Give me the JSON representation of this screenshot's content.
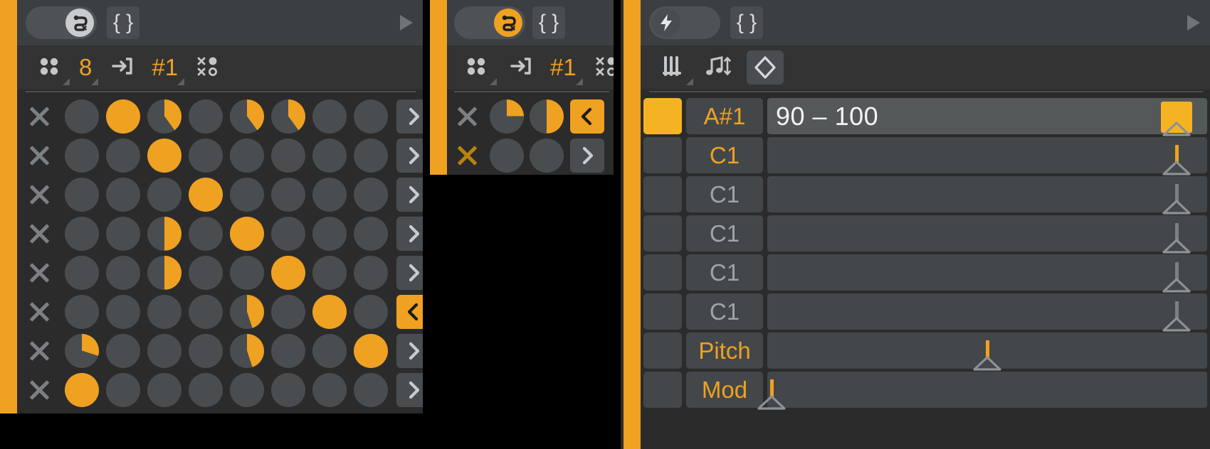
{
  "theme": {
    "accent": "#efa121",
    "panel_bg": "#2b2b2b",
    "titlebar_bg": "#3c3f41",
    "toolbar_bg": "#333333",
    "cell_bg": "#4a4d50",
    "led_on": "#f5b324",
    "text_light": "#c9ccce"
  },
  "panels": {
    "left": {
      "titlebar": {
        "toggle_icon": "snake-icon",
        "toggle_state": "off",
        "code_button": "{ }",
        "play_icon": "play-triangle-icon"
      },
      "toolbar": [
        {
          "name": "four-dots-icon",
          "icon": "four-dots",
          "value": ""
        },
        {
          "name": "step-count",
          "icon": "",
          "value": "8"
        },
        {
          "name": "enter-arrow-icon",
          "icon": "enter-arrow",
          "value": ""
        },
        {
          "name": "pattern-number",
          "icon": "",
          "value": "#1"
        },
        {
          "name": "randomize-icon",
          "icon": "x-dot-grid",
          "value": ""
        }
      ],
      "rows": [
        {
          "mute": "x",
          "mute_color": "gray",
          "steps": [
            0,
            100,
            40,
            0,
            40,
            40,
            0,
            0
          ],
          "arrow": ">",
          "arrow_selected": false
        },
        {
          "mute": "x",
          "mute_color": "gray",
          "steps": [
            0,
            0,
            100,
            0,
            0,
            0,
            0,
            0
          ],
          "arrow": ">",
          "arrow_selected": false
        },
        {
          "mute": "x",
          "mute_color": "gray",
          "steps": [
            0,
            0,
            0,
            100,
            0,
            0,
            0,
            0
          ],
          "arrow": ">",
          "arrow_selected": false
        },
        {
          "mute": "x",
          "mute_color": "gray",
          "steps": [
            0,
            0,
            50,
            0,
            100,
            0,
            0,
            0
          ],
          "arrow": ">",
          "arrow_selected": false
        },
        {
          "mute": "x",
          "mute_color": "gray",
          "steps": [
            0,
            0,
            50,
            0,
            0,
            100,
            0,
            0
          ],
          "arrow": ">",
          "arrow_selected": false
        },
        {
          "mute": "x",
          "mute_color": "gray",
          "steps": [
            0,
            0,
            0,
            0,
            45,
            0,
            100,
            0
          ],
          "arrow": "<",
          "arrow_selected": true
        },
        {
          "mute": "x",
          "mute_color": "gray",
          "steps": [
            30,
            0,
            0,
            0,
            45,
            0,
            0,
            100
          ],
          "arrow": ">",
          "arrow_selected": false
        },
        {
          "mute": "x",
          "mute_color": "gray",
          "steps": [
            100,
            0,
            0,
            0,
            0,
            0,
            0,
            0
          ],
          "arrow": ">",
          "arrow_selected": false
        }
      ]
    },
    "middle": {
      "titlebar": {
        "toggle_icon": "snake-icon",
        "toggle_state": "on",
        "code_button": "{ }",
        "play_icon": "play-triangle-icon"
      },
      "toolbar": [
        {
          "name": "four-dots-icon",
          "icon": "four-dots",
          "value": ""
        },
        {
          "name": "enter-arrow-icon",
          "icon": "enter-arrow",
          "value": ""
        },
        {
          "name": "pattern-number",
          "icon": "",
          "value": "#1"
        },
        {
          "name": "randomize-icon",
          "icon": "x-dot-grid",
          "value": ""
        }
      ],
      "rows": [
        {
          "mute": "x",
          "mute_color": "gray",
          "steps": [
            25,
            50
          ],
          "arrow": "<",
          "arrow_selected": true
        },
        {
          "mute": "x",
          "mute_color": "orange",
          "steps": [
            0,
            0
          ],
          "arrow": ">",
          "arrow_selected": false
        }
      ]
    },
    "right": {
      "titlebar": {
        "toggle_icon": "lightning-icon",
        "toggle_state": "left-on",
        "code_button": "{ }",
        "play_icon": "play-triangle-icon"
      },
      "toolbar": [
        {
          "name": "sliders-icon",
          "icon": "sliders",
          "value": ""
        },
        {
          "name": "note-updown-icon",
          "icon": "note-updown",
          "value": ""
        },
        {
          "name": "diamond-icon",
          "icon": "diamond",
          "value": "",
          "selected": true
        }
      ],
      "lanes": [
        {
          "led": true,
          "label": "A#1",
          "label_hl": true,
          "value": "90 – 100",
          "active": true,
          "handle_pct": 93,
          "swatch": true,
          "stem": false
        },
        {
          "led": false,
          "label": "C1",
          "label_hl": true,
          "value": "",
          "active": false,
          "handle_pct": 93,
          "swatch": false,
          "stem": true,
          "stem_color": "orange"
        },
        {
          "led": false,
          "label": "C1",
          "label_hl": false,
          "value": "",
          "active": false,
          "handle_pct": 93,
          "swatch": false,
          "stem": true,
          "stem_color": "gray"
        },
        {
          "led": false,
          "label": "C1",
          "label_hl": false,
          "value": "",
          "active": false,
          "handle_pct": 93,
          "swatch": false,
          "stem": true,
          "stem_color": "gray"
        },
        {
          "led": false,
          "label": "C1",
          "label_hl": false,
          "value": "",
          "active": false,
          "handle_pct": 93,
          "swatch": false,
          "stem": true,
          "stem_color": "gray"
        },
        {
          "led": false,
          "label": "C1",
          "label_hl": false,
          "value": "",
          "active": false,
          "handle_pct": 93,
          "swatch": false,
          "stem": true,
          "stem_color": "gray"
        },
        {
          "led": false,
          "label": "Pitch",
          "label_hl": true,
          "value": "",
          "active": false,
          "handle_pct": 50,
          "swatch": false,
          "stem": true,
          "stem_color": "orange"
        },
        {
          "led": false,
          "label": "Mod",
          "label_hl": true,
          "value": "",
          "active": false,
          "handle_pct": 1,
          "swatch": false,
          "stem": true,
          "stem_color": "orange"
        }
      ]
    }
  }
}
